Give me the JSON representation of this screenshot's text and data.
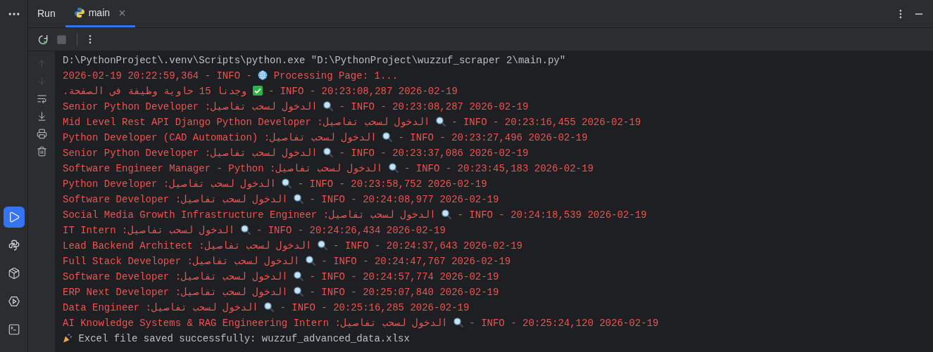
{
  "sidebar": {
    "items": [
      {
        "kind": "run",
        "selected": true
      },
      {
        "kind": "python",
        "selected": false
      },
      {
        "kind": "packages",
        "selected": false
      },
      {
        "kind": "services",
        "selected": false
      },
      {
        "kind": "terminal",
        "selected": false
      }
    ]
  },
  "tool_window": {
    "title": "Run",
    "tabs": [
      {
        "label": "main",
        "selected": true
      }
    ]
  },
  "toolbar": [
    {
      "kind": "rerun",
      "disabled": false
    },
    {
      "kind": "stop",
      "disabled": true
    }
  ],
  "gutter": [
    {
      "kind": "up",
      "disabled": true
    },
    {
      "kind": "down",
      "disabled": true
    },
    {
      "kind": "wrap",
      "disabled": false
    },
    {
      "kind": "scroll_end",
      "disabled": false
    },
    {
      "kind": "print",
      "disabled": false
    },
    {
      "kind": "clear",
      "disabled": false
    }
  ],
  "console": {
    "lines": [
      {
        "kind": "command",
        "text": "D:\\PythonProject\\.venv\\Scripts\\python.exe \"D:\\PythonProject\\wuzzuf_scraper 2\\main.py\""
      },
      {
        "kind": "log",
        "rtl": false,
        "prefix": "2026-02-19 20:22:59,364 - INFO - ",
        "icon": {
          "kind": "globe"
        },
        "message": " Processing Page: 1..."
      },
      {
        "kind": "log",
        "rtl": true,
        "prefix": "2026-02-19 20:23:08,287 - INFO - ",
        "icon": {
          "kind": "check"
        },
        "message": " وجدنا 15 حاوية وظيفة في الصفحة."
      },
      {
        "kind": "log",
        "rtl": true,
        "prefix": "2026-02-19 20:23:08,287 - INFO - ",
        "icon": {
          "kind": "search"
        },
        "message": " الدخول لسحب تفاصيل: Senior Python Developer"
      },
      {
        "kind": "log",
        "rtl": true,
        "prefix": "2026-02-19 20:23:16,455 - INFO - ",
        "icon": {
          "kind": "search"
        },
        "message": " الدخول لسحب تفاصيل: Mid Level Rest API Django Python Developer"
      },
      {
        "kind": "log",
        "rtl": true,
        "prefix": "2026-02-19 20:23:27,496 - INFO - ",
        "icon": {
          "kind": "search"
        },
        "message": " الدخول لسحب تفاصيل: Python Developer (CAD Automation)"
      },
      {
        "kind": "log",
        "rtl": true,
        "prefix": "2026-02-19 20:23:37,086 - INFO - ",
        "icon": {
          "kind": "search"
        },
        "message": " الدخول لسحب تفاصيل: Senior Python Developer"
      },
      {
        "kind": "log",
        "rtl": true,
        "prefix": "2026-02-19 20:23:45,183 - INFO - ",
        "icon": {
          "kind": "search"
        },
        "message": " الدخول لسحب تفاصيل: Software Engineer Manager - Python"
      },
      {
        "kind": "log",
        "rtl": true,
        "prefix": "2026-02-19 20:23:58,752 - INFO - ",
        "icon": {
          "kind": "search"
        },
        "message": " الدخول لسحب تفاصيل: Python Developer"
      },
      {
        "kind": "log",
        "rtl": true,
        "prefix": "2026-02-19 20:24:08,977 - INFO - ",
        "icon": {
          "kind": "search"
        },
        "message": " الدخول لسحب تفاصيل: Software Developer"
      },
      {
        "kind": "log",
        "rtl": true,
        "prefix": "2026-02-19 20:24:18,539 - INFO - ",
        "icon": {
          "kind": "search"
        },
        "message": " الدخول لسحب تفاصيل: Social Media Growth Infrastructure Engineer"
      },
      {
        "kind": "log",
        "rtl": true,
        "prefix": "2026-02-19 20:24:26,434 - INFO - ",
        "icon": {
          "kind": "search"
        },
        "message": " الدخول لسحب تفاصيل: IT Intern"
      },
      {
        "kind": "log",
        "rtl": true,
        "prefix": "2026-02-19 20:24:37,643 - INFO - ",
        "icon": {
          "kind": "search"
        },
        "message": " الدخول لسحب تفاصيل: Lead Backend Architect"
      },
      {
        "kind": "log",
        "rtl": true,
        "prefix": "2026-02-19 20:24:47,767 - INFO - ",
        "icon": {
          "kind": "search"
        },
        "message": " الدخول لسحب تفاصيل: Full Stack Developer"
      },
      {
        "kind": "log",
        "rtl": true,
        "prefix": "2026-02-19 20:24:57,774 - INFO - ",
        "icon": {
          "kind": "search"
        },
        "message": " الدخول لسحب تفاصيل: Software Developer"
      },
      {
        "kind": "log",
        "rtl": true,
        "prefix": "2026-02-19 20:25:07,840 - INFO - ",
        "icon": {
          "kind": "search"
        },
        "message": " الدخول لسحب تفاصيل: ERP Next Developer"
      },
      {
        "kind": "log",
        "rtl": true,
        "prefix": "2026-02-19 20:25:16,285 - INFO - ",
        "icon": {
          "kind": "search"
        },
        "message": " الدخول لسحب تفاصيل: Data Engineer"
      },
      {
        "kind": "log",
        "rtl": true,
        "prefix": "2026-02-19 20:25:24,120 - INFO - ",
        "icon": {
          "kind": "search"
        },
        "message": " الدخول لسحب تفاصيل: AI Knowledge Systems & RAG Engineering Intern"
      },
      {
        "kind": "result",
        "icon": {
          "kind": "party"
        },
        "message": " Excel file saved successfully: wuzzuf_advanced_data.xlsx"
      }
    ]
  }
}
